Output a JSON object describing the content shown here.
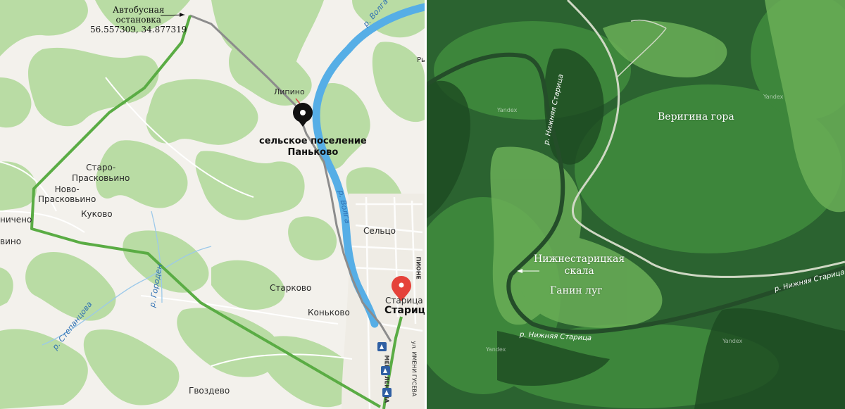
{
  "map_panel": {
    "route_color": "#5aac44",
    "river_color": "#56aee6",
    "forest_color": "#b5d9a0",
    "bus_stop": {
      "title_line1": "Автобусная",
      "title_line2": "остановка",
      "coordinates": "56.557309, 34.877319"
    },
    "destination": {
      "line1": "сельское поселение",
      "line2": "Паньково"
    },
    "places": {
      "lipino": "Липино",
      "staro_1": "Старо-",
      "staro_2": "Прасковьино",
      "novo_1": "Ново-",
      "novo_2": "Прасковьино",
      "kukovo": "Куково",
      "nichено": "ничено",
      "vino": "вино",
      "seltso": "Сельцо",
      "starkovo": "Старково",
      "konkovo": "Коньково",
      "staritsa_small": "Старица",
      "staritsa_big": "Старица",
      "gvozdevo": "Гвоздево",
      "ry": "Ры",
      "pionerskaya": "ПИОНЕ"
    },
    "rivers": {
      "volga_top": "р. Волга",
      "volga_mid": "р. Волга",
      "gorodnya": "р. Городен",
      "stepantsova": "р. Степанцова"
    },
    "streets": {
      "lenina": "МЕНИ ЛЕНИНА",
      "guseva": "ул. ИМЕНИ ГУСЕВА"
    },
    "icons": [
      "pin-marker-icon",
      "red-location-pin-icon",
      "bus-stop-icon"
    ]
  },
  "satellite_panel": {
    "labels": {
      "verigina": "Веригина гора",
      "skala_line1": "Нижнестарицкая",
      "skala_line2": "скала",
      "ganin": "Ганин луг"
    },
    "rivers": {
      "top": "р. Нижняя Старица",
      "right": "р. Нижняя Старица",
      "bottom": "р. Нижняя Старица"
    },
    "watermark": "Yandex"
  }
}
